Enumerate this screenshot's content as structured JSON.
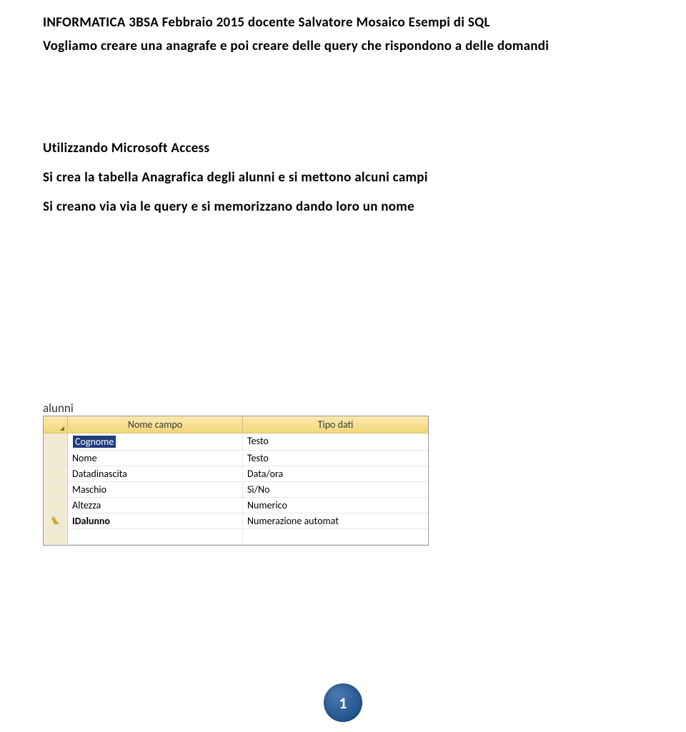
{
  "header": "INFORMATICA  3BSA Febbraio 2015 docente Salvatore Mosaico Esempi di SQL",
  "subtitle": "Vogliamo creare una anagrafe e poi creare delle query che rispondono a delle domandi",
  "section_title": "Utilizzando Microsoft Access",
  "body_line1": "Si crea la tabella Anagrafica degli alunni e si mettono alcuni campi",
  "body_line2": "Si creano via via le query e si memorizzano dando loro un nome",
  "table_caption": "alunni",
  "columns": {
    "name": "Nome campo",
    "type": "Tipo dati"
  },
  "rows": [
    {
      "name": "Cognome",
      "type": "Testo",
      "selected": true,
      "key": false
    },
    {
      "name": "Nome",
      "type": "Testo",
      "selected": false,
      "key": false
    },
    {
      "name": "Datadinascita",
      "type": "Data/ora",
      "selected": false,
      "key": false
    },
    {
      "name": "Maschio",
      "type": "Sì/No",
      "selected": false,
      "key": false
    },
    {
      "name": "Altezza",
      "type": "Numerico",
      "selected": false,
      "key": false
    },
    {
      "name": "IDalunno",
      "type": "Numerazione automat",
      "selected": false,
      "key": true
    }
  ],
  "page_number": "1"
}
